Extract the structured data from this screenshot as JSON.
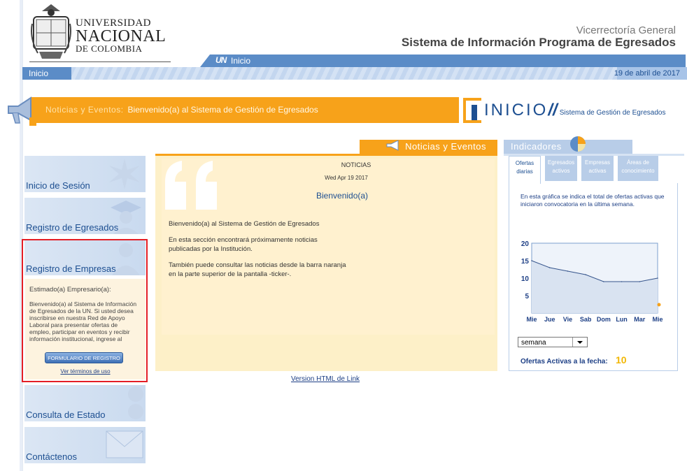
{
  "header": {
    "university_line1": "UNIVERSIDAD",
    "university_line2": "NACIONAL",
    "university_line3": "DE COLOMBIA",
    "vicerrectoria": "Vicerrectoría General",
    "system_title": "Sistema de Información Programa de Egresados",
    "inicio_un": "Inicio",
    "un_mark": "UN"
  },
  "breadcrumb": {
    "current": "Inicio",
    "date": "19 de abril de 2017"
  },
  "ticker": {
    "label": "Noticias y Eventos:",
    "message": "Bienvenido(a) al Sistema de Gestión de Egresados"
  },
  "brand": {
    "word": "INICIO",
    "slashes": "//",
    "subtitle": "Sistema de Gestión de Egresados"
  },
  "tabs": {
    "noticias": "Noticias y Eventos",
    "indicadores": "Indicadores"
  },
  "nav": {
    "items": [
      {
        "label": "Inicio de Sesión"
      },
      {
        "label": "Registro de Egresados"
      },
      {
        "label": "Registro de Empresas"
      },
      {
        "label": "Consulta de Estado"
      },
      {
        "label": "Contáctenos"
      }
    ]
  },
  "empresa": {
    "greeting": "Estimado(a) Empresario(a):",
    "body": "Bienvenido(a) al Sistema de Información de Egresados de la UN. Si usted desea inscribirse en nuestra Red de Apoyo Laboral para presentar ofertas de empleo, participar en eventos y recibir información institucional, ingrese al Formulario de",
    "button": "FORMULARIO DE  REGISTRO",
    "terms": "Ver términos de uso"
  },
  "news": {
    "title": "NOTICIAS",
    "date": "Wed Apr 19 2017",
    "headline": "Bienvenido(a)",
    "p1": "Bienvenido(a) al Sistema de Gestión de Egresados",
    "p2": "En esta sección encontrará próximamente noticias publicadas por la Institución.",
    "p3": "También puede consultar las noticias desde la barra naranja en la parte superior de la pantalla -ticker-.",
    "html_link": "Version HTML de Link"
  },
  "indicators": {
    "tabs": [
      "Ofertas diarias",
      "Egresados activos",
      "Empresas activas",
      "Áreas de conocimiento"
    ],
    "description": "En esta gráfica se indica el total de ofertas activas que iniciaron convocatoria en la última semana.",
    "period": "semana",
    "ofertas_label": "Ofertas Activas a la fecha:",
    "ofertas_value": "10"
  },
  "chart_data": {
    "type": "area",
    "categories": [
      "Mie",
      "Jue",
      "Vie",
      "Sab",
      "Dom",
      "Lun",
      "Mar",
      "Mie"
    ],
    "values": [
      15,
      13,
      12,
      11,
      9,
      9,
      9,
      10
    ],
    "yticks": [
      "5",
      "10",
      "15",
      "20"
    ],
    "ylim": [
      0,
      20
    ],
    "colors": {
      "fill": "#d9e3f1",
      "line": "#36558c",
      "frame": "#7c9fce"
    }
  }
}
